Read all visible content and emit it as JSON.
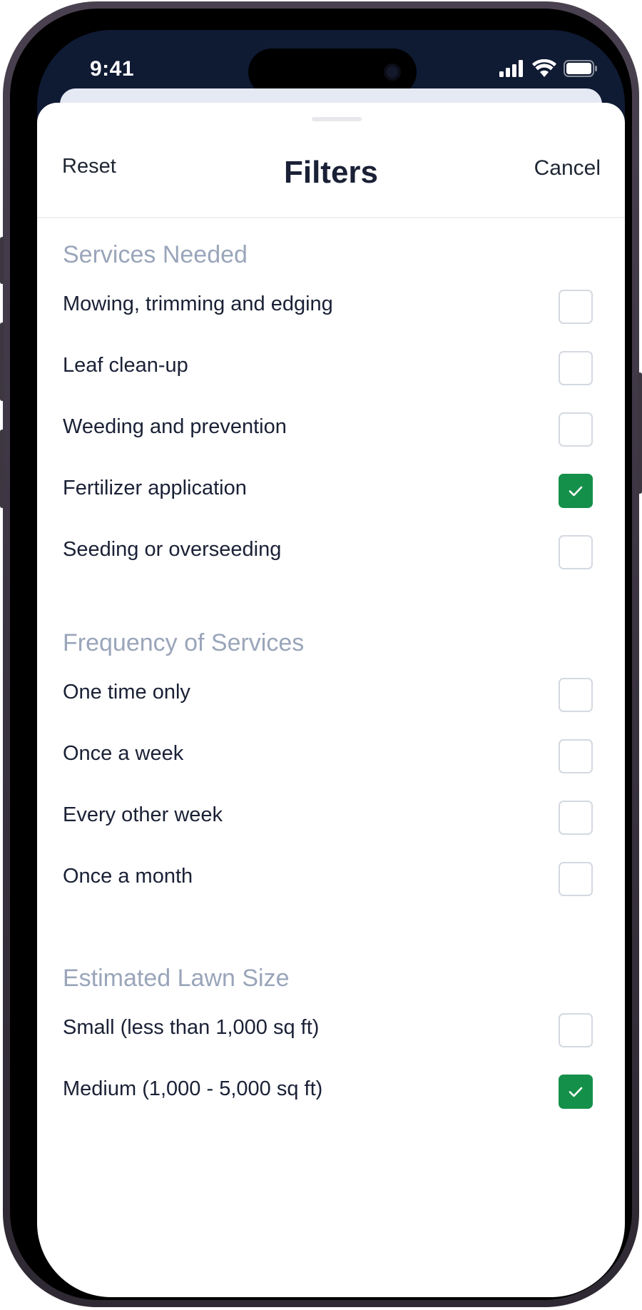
{
  "status_bar": {
    "time": "9:41"
  },
  "nav": {
    "reset_label": "Reset",
    "title": "Filters",
    "cancel_label": "Cancel"
  },
  "colors": {
    "accent": "#15904a",
    "section_title": "#9aa5ba",
    "text": "#1a2136"
  },
  "sections": [
    {
      "title": "Services Needed",
      "options": [
        {
          "label": "Mowing, trimming and edging",
          "checked": false
        },
        {
          "label": "Leaf clean-up",
          "checked": false
        },
        {
          "label": "Weeding and prevention",
          "checked": false
        },
        {
          "label": "Fertilizer application",
          "checked": true
        },
        {
          "label": "Seeding or overseeding",
          "checked": false
        }
      ]
    },
    {
      "title": "Frequency of Services",
      "options": [
        {
          "label": "One time only",
          "checked": false
        },
        {
          "label": "Once a week",
          "checked": false
        },
        {
          "label": "Every other week",
          "checked": false
        },
        {
          "label": "Once a month",
          "checked": false
        }
      ]
    },
    {
      "title": "Estimated Lawn Size",
      "options": [
        {
          "label": "Small (less than 1,000 sq ft)",
          "checked": false
        },
        {
          "label": "Medium (1,000 - 5,000 sq ft)",
          "checked": true
        }
      ]
    }
  ]
}
